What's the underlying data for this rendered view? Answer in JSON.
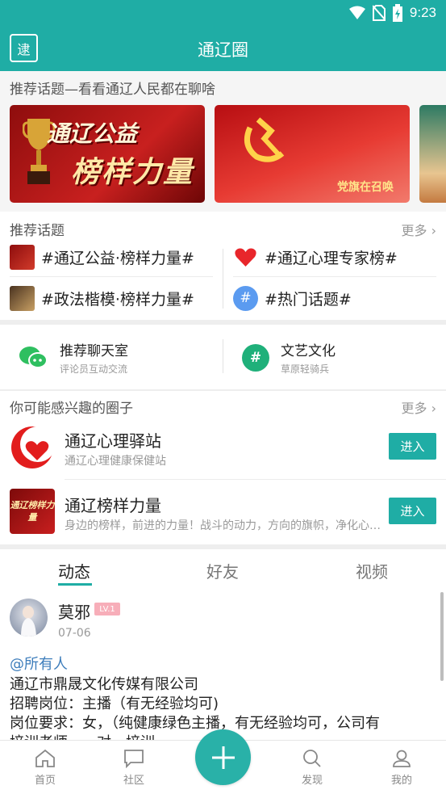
{
  "status_bar": {
    "time": "9:23"
  },
  "header": {
    "logo_text": "逮",
    "title": "通辽圈"
  },
  "banner_section": {
    "caption": "推荐话题—看看通辽人民都在聊啥",
    "banners": [
      {
        "line1": "通辽公益",
        "line2": "榜样力量"
      },
      {
        "text": "党旗在召唤"
      },
      {
        "text": ""
      }
    ]
  },
  "topics": {
    "title": "推荐话题",
    "more": "更多",
    "items": [
      {
        "label": "#通辽公益·榜样力量#"
      },
      {
        "label": "#通辽心理专家榜#"
      },
      {
        "label": "#政法楷模·榜样力量#"
      },
      {
        "label": "#热门话题#"
      }
    ]
  },
  "chat": [
    {
      "title": "推荐聊天室",
      "sub": "评论员互动交流"
    },
    {
      "title": "文艺文化",
      "sub": "草原轻骑兵",
      "icon_char": "#"
    }
  ],
  "circles": {
    "title": "你可能感兴趣的圈子",
    "more": "更多",
    "items": [
      {
        "name": "通辽心理驿站",
        "desc": "通辽心理健康保健站",
        "button": "进入"
      },
      {
        "name": "通辽榜样力量",
        "desc": "身边的榜样，前进的力量！战斗的动力，方向的旗帜，净化心灵的良方",
        "button": "进入",
        "logo_text": "通辽榜样力量"
      }
    ]
  },
  "tabs": [
    "动态",
    "好友",
    "视频"
  ],
  "post": {
    "user": "莫邪",
    "level": "LV.1",
    "date": "07-06",
    "mention": "@所有人",
    "lines": [
      "通辽市鼎晟文化传媒有限公司",
      "招聘岗位：主播（有无经验均可)",
      "岗位要求：女，（纯健康绿色主播，有无经验均可，公司有",
      "培训老师，一对一培训"
    ]
  },
  "bottom_nav": [
    {
      "label": "首页",
      "icon": "home-icon"
    },
    {
      "label": "社区",
      "icon": "chat-bubble-icon"
    },
    {
      "label": "发现",
      "icon": "search-icon"
    },
    {
      "label": "我的",
      "icon": "profile-icon"
    }
  ],
  "colors": {
    "accent": "#1fada5",
    "mention": "#3d7dbb",
    "badge": "#f7aeb9"
  }
}
